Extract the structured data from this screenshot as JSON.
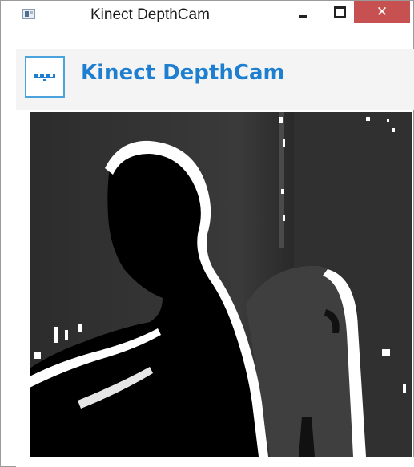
{
  "window": {
    "title": "Kinect DepthCam",
    "icon": "app-window-icon",
    "controls": {
      "minimize_icon": "minimize-icon",
      "maximize_icon": "maximize-icon",
      "close_icon": "close-icon",
      "close_glyph": "✕",
      "close_color": "#c75050"
    }
  },
  "header": {
    "logo_icon": "kinect-sensor-icon",
    "title": "Kinect DepthCam",
    "accent_color": "#1e7fd0"
  },
  "depth_view": {
    "content": "depth-image"
  }
}
